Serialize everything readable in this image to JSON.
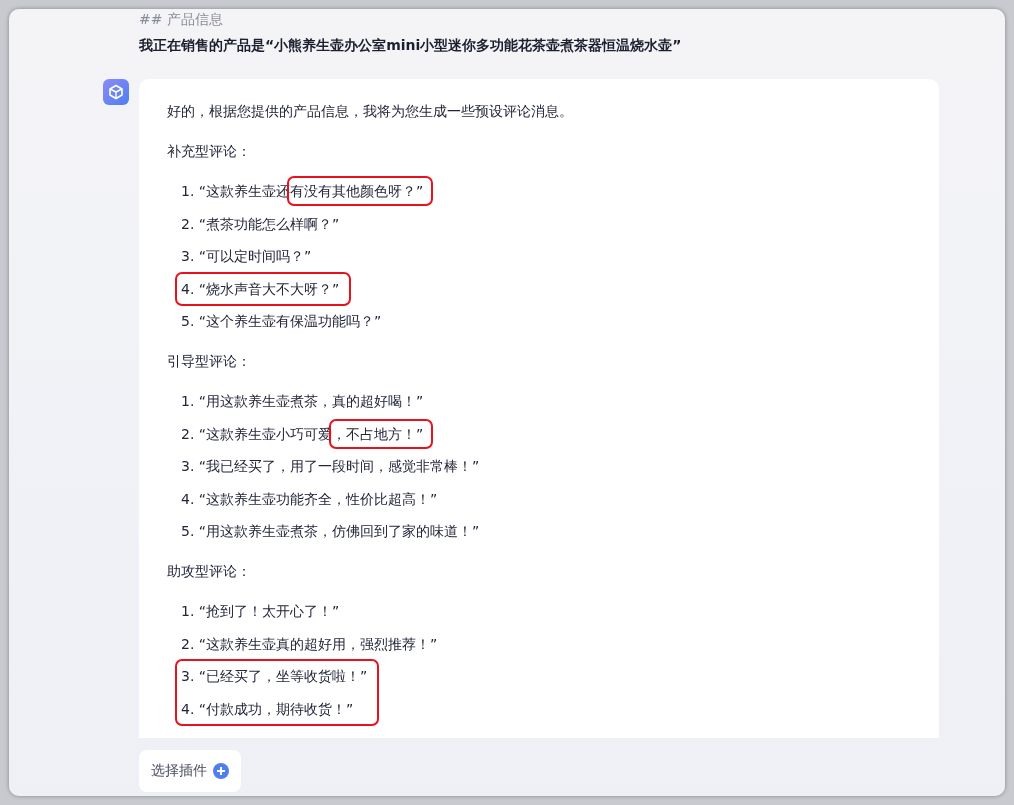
{
  "prompt": {
    "heading": "## 产品信息",
    "text": "我正在销售的产品是“小熊养生壶办公室mini小型迷你多功能花茶壶煮茶器恒温烧水壶”"
  },
  "reply": {
    "intro": "好的，根据您提供的产品信息，我将为您生成一些预设评论消息。",
    "sections": [
      {
        "title": "补充型评论：",
        "items": [
          {
            "number": "1.",
            "circled": false,
            "parts": [
              {
                "text": "“这款养生壶还",
                "circled": false
              },
              {
                "text": "有没有其他颜色呀？”",
                "circled": true
              }
            ]
          },
          {
            "number": "2.",
            "circled": false,
            "parts": [
              {
                "text": "“煮茶功能怎么样啊？”",
                "circled": false
              }
            ]
          },
          {
            "number": "3.",
            "circled": false,
            "parts": [
              {
                "text": "“可以定时间吗？”",
                "circled": false
              }
            ]
          },
          {
            "number": "4.",
            "circled": true,
            "parts": [
              {
                "text": "“烧水声音大不大呀？”",
                "circled": false
              }
            ]
          },
          {
            "number": "5.",
            "circled": false,
            "parts": [
              {
                "text": "“这个养生壶有保温功能吗？”",
                "circled": false
              }
            ]
          }
        ]
      },
      {
        "title": "引导型评论：",
        "items": [
          {
            "number": "1.",
            "circled": false,
            "parts": [
              {
                "text": "“用这款养生壶煮茶，真的超好喝！”",
                "circled": false
              }
            ]
          },
          {
            "number": "2.",
            "circled": false,
            "parts": [
              {
                "text": "“这款养生壶小巧可爱",
                "circled": false
              },
              {
                "text": "，不占地方！”",
                "circled": true
              }
            ]
          },
          {
            "number": "3.",
            "circled": false,
            "parts": [
              {
                "text": "“我已经买了，用了一段时间，感觉非常棒！”",
                "circled": false
              }
            ]
          },
          {
            "number": "4.",
            "circled": false,
            "parts": [
              {
                "text": "“这款养生壶功能齐全，性价比超高！”",
                "circled": false
              }
            ]
          },
          {
            "number": "5.",
            "circled": false,
            "parts": [
              {
                "text": "“用这款养生壶煮茶，仿佛回到了家的味道！”",
                "circled": false
              }
            ]
          }
        ]
      },
      {
        "title": "助攻型评论：",
        "items": [
          {
            "number": "1.",
            "circled": false,
            "parts": [
              {
                "text": "“抢到了！太开心了！”",
                "circled": false
              }
            ]
          },
          {
            "number": "2.",
            "circled": false,
            "parts": [
              {
                "text": "“这款养生壶真的超好用，强烈推荐！”",
                "circled": false
              }
            ]
          },
          {
            "number": "3.",
            "circled": true,
            "parts": [
              {
                "text": "“已经买了，坐等收货啦！”",
                "circled": false
              }
            ]
          },
          {
            "number": "4.",
            "circled": true,
            "parts": [
              {
                "text": "“付款成功，期待收货！”",
                "circled": false
              }
            ]
          }
        ]
      }
    ]
  },
  "plugin_button": {
    "label": "选择插件"
  }
}
